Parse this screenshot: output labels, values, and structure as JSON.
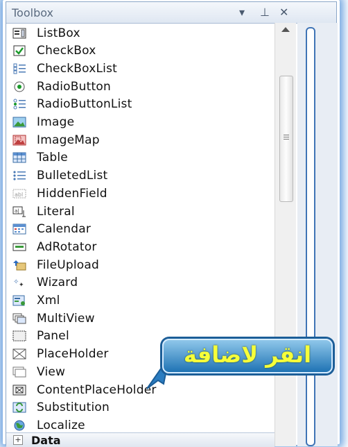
{
  "toolbox": {
    "title": "Toolbox",
    "buttons": {
      "dropdown": "▾",
      "pin": "⊥",
      "close": "✕"
    },
    "items": [
      {
        "label": "ListBox",
        "icon": "listbox-icon"
      },
      {
        "label": "CheckBox",
        "icon": "checkbox-icon"
      },
      {
        "label": "CheckBoxList",
        "icon": "checkboxlist-icon"
      },
      {
        "label": "RadioButton",
        "icon": "radiobutton-icon"
      },
      {
        "label": "RadioButtonList",
        "icon": "radiobuttonlist-icon"
      },
      {
        "label": "Image",
        "icon": "image-icon"
      },
      {
        "label": "ImageMap",
        "icon": "imagemap-icon"
      },
      {
        "label": "Table",
        "icon": "table-icon"
      },
      {
        "label": "BulletedList",
        "icon": "bulletedlist-icon"
      },
      {
        "label": "HiddenField",
        "icon": "hiddenfield-icon"
      },
      {
        "label": "Literal",
        "icon": "literal-icon"
      },
      {
        "label": "Calendar",
        "icon": "calendar-icon"
      },
      {
        "label": "AdRotator",
        "icon": "adrotator-icon"
      },
      {
        "label": "FileUpload",
        "icon": "fileupload-icon"
      },
      {
        "label": "Wizard",
        "icon": "wizard-icon"
      },
      {
        "label": "Xml",
        "icon": "xml-icon"
      },
      {
        "label": "MultiView",
        "icon": "multiview-icon"
      },
      {
        "label": "Panel",
        "icon": "panel-icon"
      },
      {
        "label": "PlaceHolder",
        "icon": "placeholder-icon"
      },
      {
        "label": "View",
        "icon": "view-icon"
      },
      {
        "label": "ContentPlaceHolder",
        "icon": "contentplaceholder-icon"
      },
      {
        "label": "Substitution",
        "icon": "substitution-icon"
      },
      {
        "label": "Localize",
        "icon": "localize-icon"
      }
    ],
    "group": {
      "label": "Data",
      "expand_icon": "+"
    }
  },
  "callout": {
    "text": "انقر لاضافة"
  },
  "colors": {
    "callout_text": "#f6ff3a",
    "callout_bg": "#1f73b4",
    "glow": "#5a96dc"
  }
}
